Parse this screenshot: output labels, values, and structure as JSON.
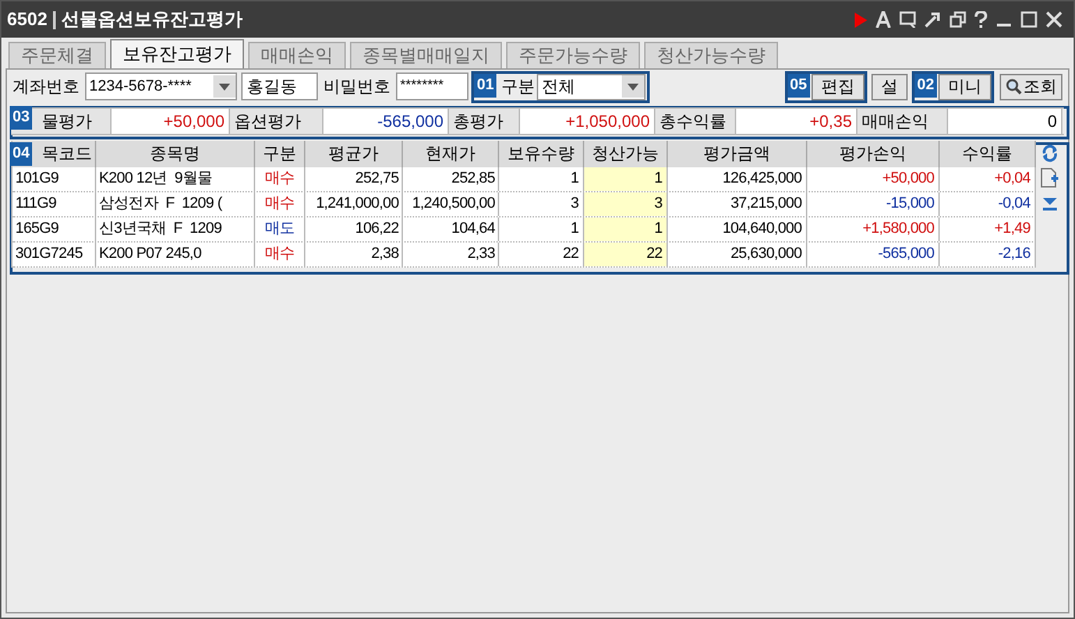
{
  "window": {
    "code": "6502",
    "title": "선물옵션보유잔고평가"
  },
  "tabs": [
    {
      "label": "주문체결",
      "selected": false
    },
    {
      "label": "보유잔고평가",
      "selected": true
    },
    {
      "label": "매매손익",
      "selected": false
    },
    {
      "label": "종목별매매일지",
      "selected": false
    },
    {
      "label": "주문가능수량",
      "selected": false
    },
    {
      "label": "청산가능수량",
      "selected": false
    }
  ],
  "toolbar": {
    "account_label": "계좌번호",
    "account_value": "1234-5678-****",
    "account_name": "홍길동",
    "password_label": "비밀번호",
    "password_value": "********",
    "category_label": "구분",
    "category_value": "전체",
    "buttons": [
      {
        "label": "편집",
        "kind": "plain"
      },
      {
        "label": "설",
        "kind": "plain"
      },
      {
        "label": "미니",
        "kind": "plain"
      },
      {
        "label": "조회",
        "kind": "search"
      }
    ]
  },
  "summary": [
    {
      "label": "물평가",
      "value": "+50,000",
      "color": "#d01010"
    },
    {
      "label": "옵션평가",
      "value": "-565,000",
      "color": "#1030a0"
    },
    {
      "label": "총평가",
      "value": "+1,050,000",
      "color": "#d01010"
    },
    {
      "label": "총수익률",
      "value": "+0,35",
      "color": "#d01010"
    },
    {
      "label": "매매손익",
      "value": "0",
      "color": "#000000"
    }
  ],
  "table": {
    "columns": [
      "목코드",
      "종목명",
      "구분",
      "평균가",
      "현재가",
      "보유수량",
      "청산가능",
      "평가금액",
      "평가손익",
      "수익률"
    ],
    "rows": [
      {
        "code": "101G9",
        "name": "K200 12년  9월물",
        "side": {
          "label": "매수",
          "color": "#d01010"
        },
        "avg": "252,75",
        "current": "252,85",
        "qty": "1",
        "closable": "1",
        "amount": "126,425,000",
        "pl": "+50,000",
        "rate": "+0,04",
        "color": "#d01010"
      },
      {
        "code": "111G9",
        "name": "삼성전자  F  1209 (",
        "side": {
          "label": "매수",
          "color": "#d01010"
        },
        "avg": "1,241,000,00",
        "current": "1,240,500,00",
        "qty": "3",
        "closable": "3",
        "amount": "37,215,000",
        "pl": "-15,000",
        "rate": "-0,04",
        "color": "#1030a0"
      },
      {
        "code": "165G9",
        "name": "신3년국채  F  1209",
        "side": {
          "label": "매도",
          "color": "#1030a0"
        },
        "avg": "106,22",
        "current": "104,64",
        "qty": "1",
        "closable": "1",
        "amount": "104,640,000",
        "pl": "+1,580,000",
        "rate": "+1,49",
        "color": "#d01010"
      },
      {
        "code": "301G7245",
        "name": "K200 P07 245,0",
        "side": {
          "label": "매수",
          "color": "#d01010"
        },
        "avg": "2,38",
        "current": "2,33",
        "qty": "22",
        "closable": "22",
        "amount": "25,630,000",
        "pl": "-565,000",
        "rate": "-2,16",
        "color": "#1030a0"
      }
    ]
  },
  "callouts": [
    {
      "label": "01"
    },
    {
      "label": "05"
    },
    {
      "label": "02"
    },
    {
      "label": "03"
    },
    {
      "label": "04"
    }
  ]
}
